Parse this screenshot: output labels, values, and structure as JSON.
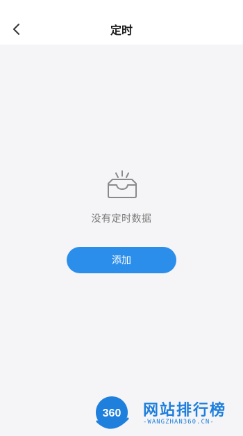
{
  "header": {
    "title": "定时",
    "back_icon": "chevron-left-icon"
  },
  "empty_state": {
    "icon": "empty-inbox-icon",
    "message": "没有定时数据"
  },
  "actions": {
    "add_label": "添加"
  },
  "colors": {
    "accent": "#2b8eea",
    "background": "#f5f5f7",
    "header_bg": "#ffffff"
  },
  "watermark": {
    "logo_text": "360",
    "title": "网站排行榜",
    "subtitle": "-WANGZHAN360.CN-"
  }
}
